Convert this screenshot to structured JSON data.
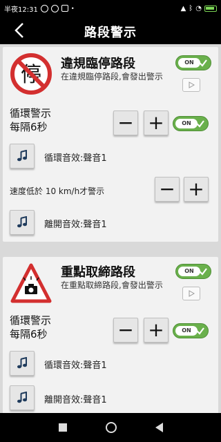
{
  "status": {
    "time": "半夜12:31",
    "battery_color": "#7ed957",
    "left_icons": [
      "alarm-icon",
      "sync-icon",
      "qr-icon",
      "dot-icon"
    ],
    "right_icons": [
      "signal-icon",
      "bluetooth-off-icon",
      "wifi-icon",
      "battery-icon"
    ]
  },
  "header": {
    "title": "路段警示",
    "back_icon": "chevron-left-icon"
  },
  "toggle_on_label": "ON",
  "cards": [
    {
      "sign_text": "停",
      "title": "違規臨停路段",
      "description": "在違規臨停路段,會發出警示",
      "enabled": true,
      "loop": {
        "line1": "循環警示",
        "line2": "每隔6秒",
        "enabled": true
      },
      "loop_sound": "循環音效:聲音1",
      "speed": "速度低於 10 km/h才警示",
      "leave_sound": "離開音效:聲音1"
    },
    {
      "sign_text": "",
      "title": "重點取締路段",
      "description": "在重點取締路段,會發出警示",
      "enabled": true,
      "loop": {
        "line1": "循環警示",
        "line2": "每隔6秒",
        "enabled": true
      },
      "loop_sound": "循環音效:聲音1",
      "leave_sound": "離開音效:聲音1"
    }
  ],
  "controls": {
    "minus": "−",
    "plus": "+"
  },
  "colors": {
    "toggle_green": "#6ab04c",
    "sign_red": "#d32f2f"
  }
}
